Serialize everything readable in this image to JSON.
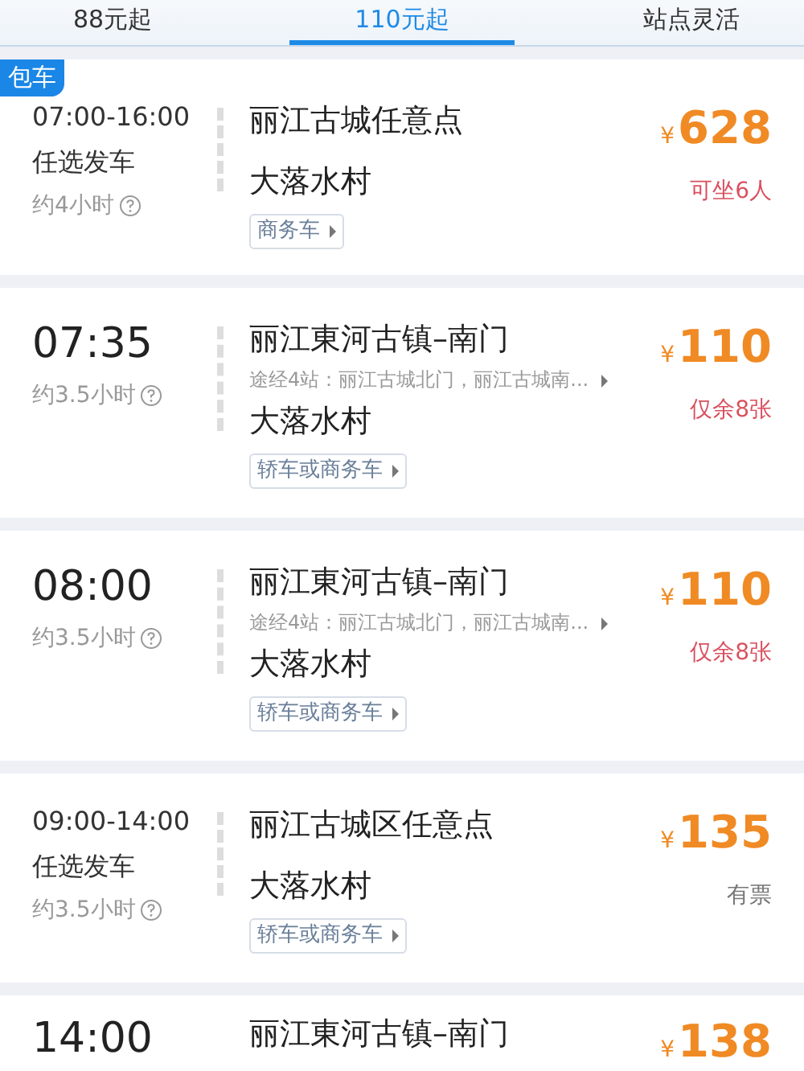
{
  "tabs": [
    {
      "label": "88元起",
      "selected": false
    },
    {
      "label": "110元起",
      "selected": true
    },
    {
      "label": "站点灵活",
      "selected": false
    }
  ],
  "trips": [
    {
      "badge": "包车",
      "kind": "range",
      "time": "07:00-16:00",
      "note": "任选发车",
      "duration": "约4小时",
      "from": "丽江古城任意点",
      "to": "大落水村",
      "vehicle": "商务车",
      "currency": "¥",
      "price": "628",
      "availability": "可坐6人",
      "color": "#d9505f"
    },
    {
      "kind": "fixed",
      "time": "07:35",
      "duration": "约3.5小时",
      "from": "丽江東河古镇–南门",
      "via": "途经4站：丽江古城北门，丽江古城南...",
      "to": "大落水村",
      "vehicle": "轿车或商务车",
      "currency": "¥",
      "price": "110",
      "availability": "仅余8张",
      "color": "#d9505f"
    },
    {
      "kind": "fixed",
      "time": "08:00",
      "duration": "约3.5小时",
      "from": "丽江東河古镇–南门",
      "via": "途经4站：丽江古城北门，丽江古城南...",
      "to": "大落水村",
      "vehicle": "轿车或商务车",
      "currency": "¥",
      "price": "110",
      "availability": "仅余8张",
      "color": "#d9505f"
    },
    {
      "kind": "range",
      "time": "09:00-14:00",
      "note": "任选发车",
      "duration": "约3.5小时",
      "from": "丽江古城区任意点",
      "to": "大落水村",
      "vehicle": "轿车或商务车",
      "currency": "¥",
      "price": "135",
      "availability": "有票",
      "color": "#777777"
    },
    {
      "kind": "fixed",
      "time": "14:00",
      "from": "丽江東河古镇–南门",
      "currency": "¥",
      "price": "138"
    }
  ]
}
